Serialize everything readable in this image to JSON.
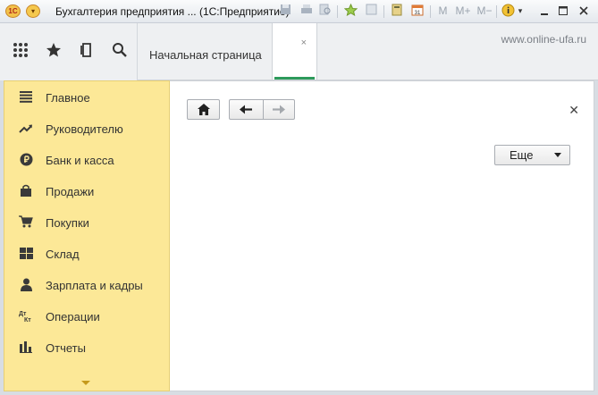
{
  "window": {
    "title": "Бухгалтерия предприятия ... (1С:Предприятие)",
    "logo_text": "1С",
    "toolbar_text": {
      "m": "M",
      "m_plus": "M+",
      "m_minus": "M−"
    }
  },
  "header": {
    "watermark": "www.online-ufa.ru"
  },
  "tabs": [
    {
      "label": "Начальная страница"
    }
  ],
  "sidebar": {
    "items": [
      {
        "label": "Главное",
        "icon": "menu-lines-icon"
      },
      {
        "label": "Руководителю",
        "icon": "trend-chart-icon"
      },
      {
        "label": "Банк и касса",
        "icon": "ruble-coin-icon"
      },
      {
        "label": "Продажи",
        "icon": "shopping-bag-icon"
      },
      {
        "label": "Покупки",
        "icon": "cart-icon"
      },
      {
        "label": "Склад",
        "icon": "warehouse-grid-icon"
      },
      {
        "label": "Зарплата и кадры",
        "icon": "person-icon"
      },
      {
        "label": "Операции",
        "icon": "debit-credit-icon"
      },
      {
        "label": "Отчеты",
        "icon": "bar-chart-icon"
      }
    ]
  },
  "content": {
    "more_button": "Еще"
  },
  "colors": {
    "sidebar_bg": "#fce897",
    "active_tab_accent": "#2d9a5b"
  }
}
